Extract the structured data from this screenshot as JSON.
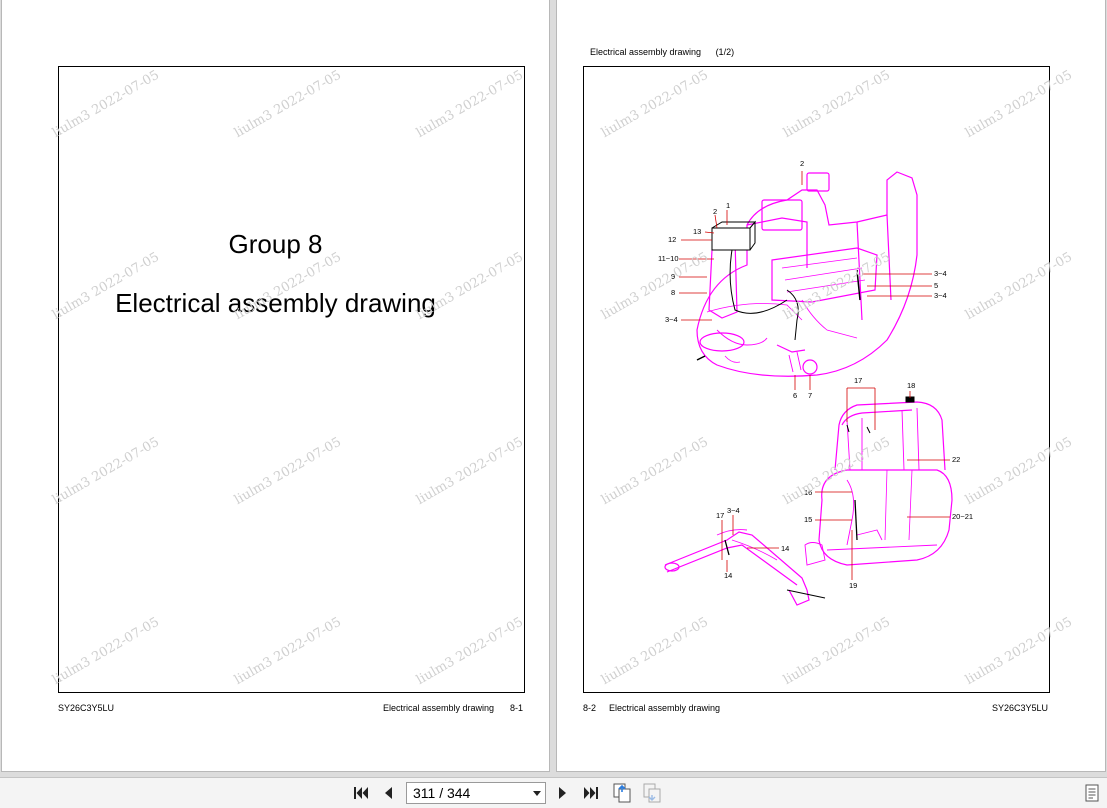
{
  "left_page": {
    "group_title": "Group 8",
    "section_title": "Electrical assembly drawing",
    "footer_left": "SY26C3Y5LU",
    "footer_right": "Electrical assembly drawing",
    "page_number": "8-1"
  },
  "right_page": {
    "header_title": "Electrical assembly drawing",
    "header_part": "(1/2)",
    "footer_page_number": "8-2",
    "footer_title": "Electrical assembly drawing",
    "footer_right": "SY26C3Y5LU",
    "callouts": [
      "1",
      "2",
      "2",
      "13",
      "12",
      "11~10",
      "9",
      "8",
      "3~4",
      "3~4",
      "5",
      "3~4",
      "6",
      "7",
      "17",
      "18",
      "22",
      "16",
      "15",
      "20~21",
      "19",
      "17",
      "3~4",
      "14",
      "14"
    ]
  },
  "watermark": "liulm3 2022-07-05",
  "toolbar": {
    "page_indicator": "311 / 344",
    "icons": [
      "first-page-icon",
      "prev-page-icon",
      "next-page-icon",
      "last-page-icon",
      "copy-page-icon",
      "copy-page-disabled-icon",
      "document-icon"
    ]
  },
  "colors": {
    "drawing": "#ff00ff",
    "watermark": "#cfcfcf",
    "background": "#dcdcdc",
    "callout": "#ff0000"
  }
}
